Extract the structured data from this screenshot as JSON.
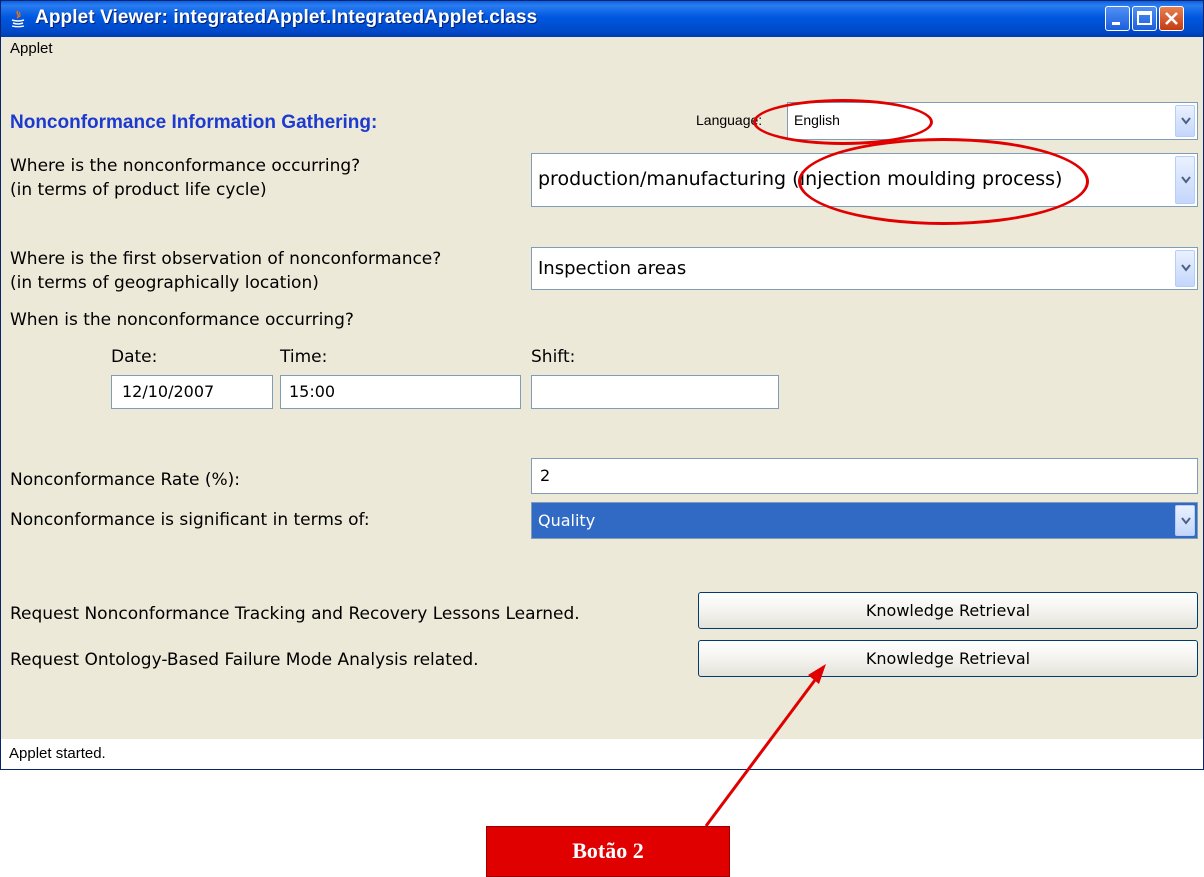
{
  "window": {
    "title": "Applet Viewer: integratedApplet.IntegratedApplet.class",
    "menu": [
      "Applet"
    ],
    "status": "Applet started."
  },
  "form": {
    "heading": "Nonconformance Information Gathering:",
    "language_label": "Language:",
    "language_value": "English",
    "q1_line1": "Where is the nonconformance occurring?",
    "q1_line2": "(in terms of product life cycle)",
    "q1_value": "production/manufacturing (Injection moulding process)",
    "q2_line1": "Where is the first observation of nonconformance?",
    "q2_line2": "(in terms of geographically location)",
    "q2_value": "Inspection areas",
    "when_label": "When is the nonconformance occurring?",
    "date_label": "Date:",
    "time_label": "Time:",
    "shift_label": "Shift:",
    "date_value": "12/10/2007",
    "time_value": "15:00",
    "shift_value": "",
    "rate_label": "Nonconformance Rate (%):",
    "rate_value": "2",
    "significance_label": "Nonconformance is significant in terms of:",
    "significance_value": "Quality",
    "request1_label": "Request Nonconformance Tracking and Recovery Lessons Learned.",
    "request1_button": "Knowledge Retrieval",
    "request2_label": "Request Ontology-Based Failure Mode Analysis related.",
    "request2_button": "Knowledge Retrieval"
  },
  "annotation": {
    "callout_label": "Botão 2",
    "color": "#e00000"
  },
  "colors": {
    "titlebar": "#0058e0",
    "heading": "#1c3ad0",
    "selection": "#316ac5",
    "window_bg": "#ece9d8"
  }
}
